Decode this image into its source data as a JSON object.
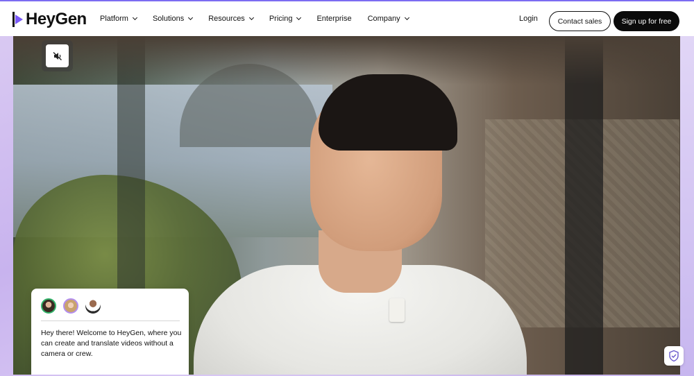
{
  "brand": {
    "name": "HeyGen",
    "accent": "#7a5af8"
  },
  "nav": {
    "items": [
      {
        "label": "Platform",
        "has_dropdown": true
      },
      {
        "label": "Solutions",
        "has_dropdown": true
      },
      {
        "label": "Resources",
        "has_dropdown": true
      },
      {
        "label": "Pricing",
        "has_dropdown": true
      },
      {
        "label": "Enterprise",
        "has_dropdown": false
      },
      {
        "label": "Company",
        "has_dropdown": true
      }
    ],
    "login_label": "Login",
    "contact_label": "Contact sales",
    "signup_label": "Sign up for free"
  },
  "hero": {
    "mute_icon": "speaker-muted-icon",
    "card": {
      "avatars": [
        "avatar-1",
        "avatar-2",
        "avatar-3"
      ],
      "message": "Hey there! Welcome to HeyGen, where you can create and translate videos without a camera or crew."
    },
    "shield_icon": "shield-check-icon"
  }
}
